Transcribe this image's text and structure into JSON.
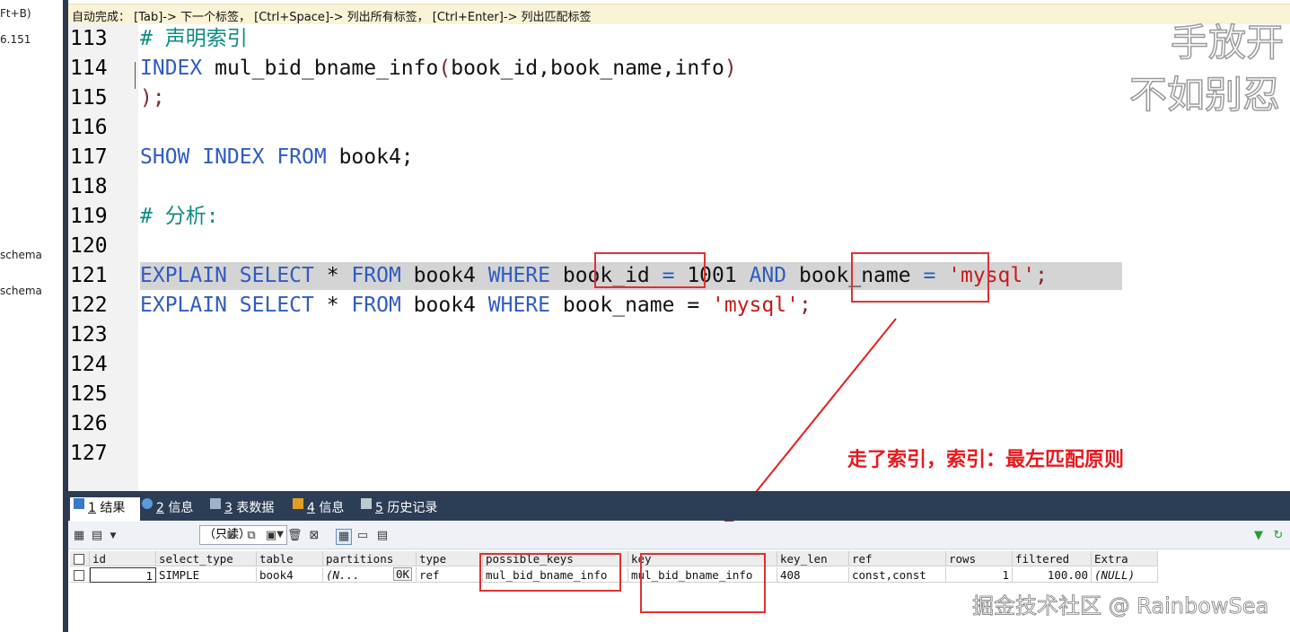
{
  "left_panel": {
    "items": [
      "Ft+B)",
      "6.151",
      "schema",
      "schema"
    ]
  },
  "hint_bar": {
    "text": "自动完成： [Tab]-> 下一个标签， [Ctrl+Space]-> 列出所有标签， [Ctrl+Enter]-> 列出匹配标签"
  },
  "editor": {
    "line_numbers": [
      "113",
      "114",
      "115",
      "116",
      "117",
      "118",
      "119",
      "120",
      "121",
      "122",
      "123",
      "124",
      "125",
      "126",
      "127"
    ],
    "lines": {
      "l113": "# 声明索引",
      "l114_kw": "INDEX",
      "l114_name": " mul_bid_bname_info",
      "l114_open": "(",
      "l114_args": "book_id,book_name,info",
      "l114_close": ")",
      "l115": ");",
      "l117_kw": "SHOW INDEX FROM",
      "l117_rest": " book4;",
      "l119": "# 分析:",
      "l121_kw1": "EXPLAIN SELECT",
      "l121_star": " * ",
      "l121_kw2": "FROM",
      "l121_tbl": " book4 ",
      "l121_kw3": "WHERE",
      "l121_col1": " book_id ",
      "l121_eq1": "=",
      "l121_num": " 1001 ",
      "l121_and": "AND",
      "l121_col2": " book_name ",
      "l121_eq2": "=",
      "l121_str": " 'mysql'",
      "l121_semi": ";",
      "l122_kw1": "EXPLAIN SELECT",
      "l122_star": " * ",
      "l122_kw2": "FROM",
      "l122_tbl": " book4 ",
      "l122_kw3": "WHERE",
      "l122_col": " book_name = ",
      "l122_str": "'mysql'",
      "l122_semi": ";"
    }
  },
  "watermark": {
    "line1": "手放开",
    "line2": "不如别忍"
  },
  "annotation": "走了索引，索引：最左匹配原则",
  "results_tabs": [
    {
      "num": "1",
      "label": "结果"
    },
    {
      "num": "2",
      "label": "信息"
    },
    {
      "num": "3",
      "label": "表数据"
    },
    {
      "num": "4",
      "label": "信息"
    },
    {
      "num": "5",
      "label": "历史记录"
    }
  ],
  "toolbar": {
    "mode_select": "（只读）"
  },
  "explain_table": {
    "columns": [
      "id",
      "select_type",
      "table",
      "partitions",
      "type",
      "possible_keys",
      "key",
      "key_len",
      "ref",
      "rows",
      "filtered",
      "Extra"
    ],
    "row": {
      "id": "1",
      "select_type": "SIMPLE",
      "table": "book4",
      "partitions": "(N...",
      "partitions_size": "0K",
      "type": "ref",
      "possible_keys": "mul_bid_bname_info",
      "key": "mul_bid_bname_info",
      "key_len": "408",
      "ref": "const,const",
      "rows": "1",
      "filtered": "100.00",
      "extra": "(NULL)"
    }
  },
  "footer_watermark": "掘金技术社区 @ RainbowSea",
  "colors": {
    "keyword": "#2f5cc0",
    "comment": "#0e8a83",
    "string": "#c61a1a",
    "annotation": "#e8191e",
    "tab_bar": "#2c3e56"
  }
}
